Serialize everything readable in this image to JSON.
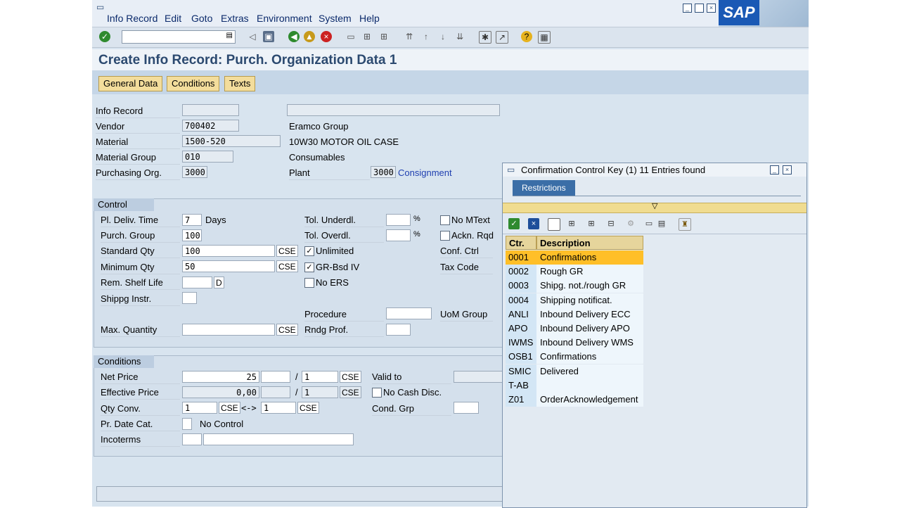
{
  "menu": [
    "Info Record",
    "Edit",
    "Goto",
    "Extras",
    "Environment",
    "System",
    "Help"
  ],
  "logo": "SAP",
  "window_controls": [
    "□",
    "□",
    "×"
  ],
  "page_title": "Create Info Record: Purch. Organization Data 1",
  "tabs": [
    "General Data",
    "Conditions",
    "Texts"
  ],
  "header": {
    "info_record_label": "Info Record",
    "vendor_label": "Vendor",
    "vendor_value": "700402",
    "vendor_name": "Eramco Group",
    "material_label": "Material",
    "material_value": "1500-520",
    "material_name": "10W30 MOTOR OIL CASE",
    "material_group_label": "Material Group",
    "material_group_value": "010",
    "material_group_name": "Consumables",
    "purch_org_label": "Purchasing Org.",
    "purch_org_value": "3000",
    "plant_label": "Plant",
    "plant_value": "3000",
    "plant_name": "Consignment"
  },
  "control": {
    "heading": "Control",
    "pl_deliv_label": "Pl. Deliv. Time",
    "pl_deliv_value": "7",
    "days": "Days",
    "purch_group_label": "Purch. Group",
    "purch_group_value": "100",
    "std_qty_label": "Standard Qty",
    "std_qty_value": "100",
    "std_qty_unit": "CSE",
    "min_qty_label": "Minimum Qty",
    "min_qty_value": "50",
    "min_qty_unit": "CSE",
    "shelf_life_label": "Rem. Shelf Life",
    "shelf_life_unit": "D",
    "shippg_label": "Shippg Instr.",
    "max_qty_label": "Max. Quantity",
    "max_qty_unit": "CSE",
    "tol_under_label": "Tol. Underdl.",
    "tol_over_label": "Tol. Overdl.",
    "percent": "%",
    "unlimited_label": "Unlimited",
    "grbsd_label": "GR-Bsd IV",
    "no_ers_label": "No ERS",
    "procedure_label": "Procedure",
    "rndg_label": "Rndg Prof.",
    "no_mtext_label": "No MText",
    "ackn_label": "Ackn. Rqd",
    "conf_ctrl_label": "Conf. Ctrl",
    "tax_code_label": "Tax Code",
    "uom_group_label": "UoM Group",
    "check": "✓"
  },
  "conditions": {
    "heading": "Conditions",
    "net_price_label": "Net Price",
    "net_price_value": "25",
    "net_per": "1",
    "net_unit": "CSE",
    "eff_price_label": "Effective Price",
    "eff_price_value": "0,00",
    "eff_per": "1",
    "eff_unit": "CSE",
    "qty_conv_label": "Qty Conv.",
    "qty_conv_a": "1",
    "qty_conv_a_unit": "CSE",
    "arrow": "<->",
    "qty_conv_b": "1",
    "qty_conv_b_unit": "CSE",
    "pr_date_label": "Pr. Date Cat.",
    "no_control": "No Control",
    "incoterms_label": "Incoterms",
    "valid_to_label": "Valid to",
    "no_cash_label": "No Cash Disc.",
    "cond_grp_label": "Cond. Grp",
    "slash": "/"
  },
  "popup": {
    "title": "Confirmation Control Key (1)  11 Entries found",
    "tab": "Restrictions",
    "funnel": "▽",
    "col_key": "Ctr.",
    "col_desc": "Description",
    "rows": [
      {
        "key": "0001",
        "desc": "Confirmations"
      },
      {
        "key": "0002",
        "desc": "Rough GR"
      },
      {
        "key": "0003",
        "desc": "Shipg. not./rough GR"
      },
      {
        "key": "0004",
        "desc": "Shipping notificat."
      },
      {
        "key": "ANLI",
        "desc": "Inbound Delivery ECC"
      },
      {
        "key": "APO",
        "desc": "Inbound Delivery APO"
      },
      {
        "key": "IWMS",
        "desc": "Inbound Delivery WMS"
      },
      {
        "key": "OSB1",
        "desc": "Confirmations"
      },
      {
        "key": "SMIC",
        "desc": "Delivered"
      },
      {
        "key": "T-AB",
        "desc": ""
      },
      {
        "key": "Z01",
        "desc": "OrderAcknowledgement"
      }
    ]
  },
  "colors": {
    "accent": "#3b6ea7",
    "selected": "#ffbf28",
    "button": "#f3dd9c",
    "title": "#2c4a70"
  }
}
